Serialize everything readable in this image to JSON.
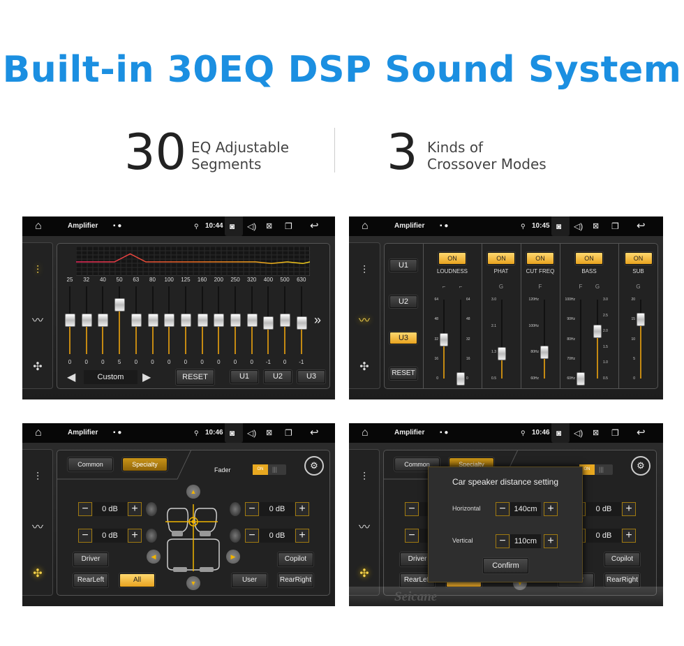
{
  "headline": "Built-in 30EQ DSP Sound System",
  "stats": [
    {
      "number": "30",
      "line1": "EQ Adjustable",
      "line2": "Segments"
    },
    {
      "number": "3",
      "line1": "Kinds of",
      "line2": "Crossover Modes"
    }
  ],
  "statusbar": {
    "app": "Amplifier",
    "times": [
      "10:44",
      "10:45",
      "10:46",
      "10:46"
    ]
  },
  "accent": "#f0b400",
  "eq": {
    "bands": [
      "25",
      "32",
      "40",
      "50",
      "63",
      "80",
      "100",
      "125",
      "160",
      "200",
      "250",
      "320",
      "400",
      "500",
      "630"
    ],
    "values": [
      0,
      0,
      0,
      5,
      0,
      0,
      0,
      0,
      0,
      0,
      0,
      0,
      -1,
      0,
      -1
    ],
    "preset": "Custom",
    "reset": "RESET",
    "users": [
      "U1",
      "U2",
      "U3"
    ],
    "more": "»"
  },
  "crossover": {
    "users": [
      "U1",
      "U2",
      "U3"
    ],
    "selected_user": "U3",
    "reset": "RESET",
    "on": "ON",
    "sections": [
      {
        "name": "LOUDNESS",
        "sub": [
          "⌐",
          "⌐"
        ]
      },
      {
        "name": "PHAT",
        "sub": [
          "G"
        ]
      },
      {
        "name": "CUT FREQ",
        "sub": [
          "F"
        ]
      },
      {
        "name": "BASS",
        "sub": [
          "F",
          "G"
        ]
      },
      {
        "name": "SUB",
        "sub": [
          "G"
        ]
      }
    ],
    "sliders": [
      {
        "ticks": [
          "64",
          "48",
          "32",
          "16",
          "0"
        ],
        "min": 0,
        "max": 64,
        "value": 32
      },
      {
        "ticks": [
          "64",
          "48",
          "32",
          "16",
          "0"
        ],
        "min": 0,
        "max": 64,
        "value": 0
      },
      {
        "ticks": [
          "3.0",
          "2.1",
          "1.3",
          "0.5"
        ],
        "min": 0.5,
        "max": 3.0,
        "value": 1.3
      },
      {
        "ticks": [
          "120Hz",
          "100Hz",
          "80Hz",
          "60Hz"
        ],
        "min": 60,
        "max": 120,
        "value": 80
      },
      {
        "ticks": [
          "100Hz",
          "90Hz",
          "80Hz",
          "70Hz",
          "60Hz"
        ],
        "min": 60,
        "max": 100,
        "value": 60
      },
      {
        "ticks": [
          "3.0",
          "2.5",
          "2.0",
          "1.5",
          "1.0",
          "0.5"
        ],
        "min": 0.5,
        "max": 3.0,
        "value": 2.0
      },
      {
        "ticks": [
          "20",
          "15",
          "10",
          "5",
          "0"
        ],
        "min": 0,
        "max": 20,
        "value": 15
      }
    ]
  },
  "balance": {
    "common": "Common",
    "specialty": "Specialty",
    "fader": "Fader",
    "fader_state": "ON",
    "gains": [
      "0 dB",
      "0 dB",
      "0 dB",
      "0 dB"
    ],
    "buttons": {
      "driver": "Driver",
      "copilot": "Copilot",
      "rearleft": "RearLeft",
      "all": "All",
      "user": "User",
      "rearright": "RearRight"
    }
  },
  "dialog": {
    "title": "Car speaker distance setting",
    "horizontal_label": "Horizontal",
    "horizontal": "140cm",
    "vertical_label": "Vertical",
    "vertical": "110cm",
    "confirm": "Confirm"
  },
  "watermark": "Seicane"
}
